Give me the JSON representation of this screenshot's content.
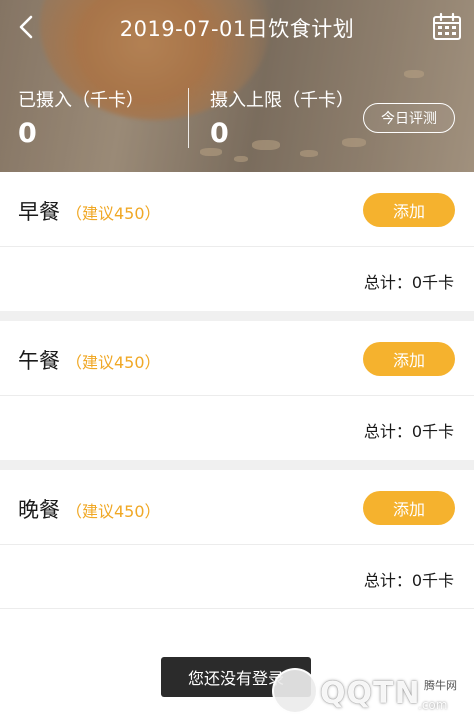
{
  "header": {
    "title": "2019-07-01日饮食计划",
    "back_icon": "chevron-left-icon",
    "calendar_icon": "calendar-icon"
  },
  "stats": {
    "intake_label": "已摄入（千卡）",
    "intake_value": "0",
    "limit_label": "摄入上限（千卡）",
    "limit_value": "0",
    "evaluate_button": "今日评测"
  },
  "meals": [
    {
      "name": "早餐",
      "suggest": "（建议450）",
      "add_label": "添加",
      "total": "总计：0千卡"
    },
    {
      "name": "午餐",
      "suggest": "（建议450）",
      "add_label": "添加",
      "total": "总计：0千卡"
    },
    {
      "name": "晚餐",
      "suggest": "（建议450）",
      "add_label": "添加",
      "total": "总计：0千卡"
    }
  ],
  "toast": {
    "text": "您还没有登录"
  },
  "watermark": {
    "brand": "腾牛网",
    "site": "QQTN",
    "domain": ".com"
  },
  "colors": {
    "accent": "#f5b22e",
    "suggest_text": "#f0a826",
    "toast_bg": "#2b2b2b",
    "section_gap": "#f0f0f0"
  }
}
